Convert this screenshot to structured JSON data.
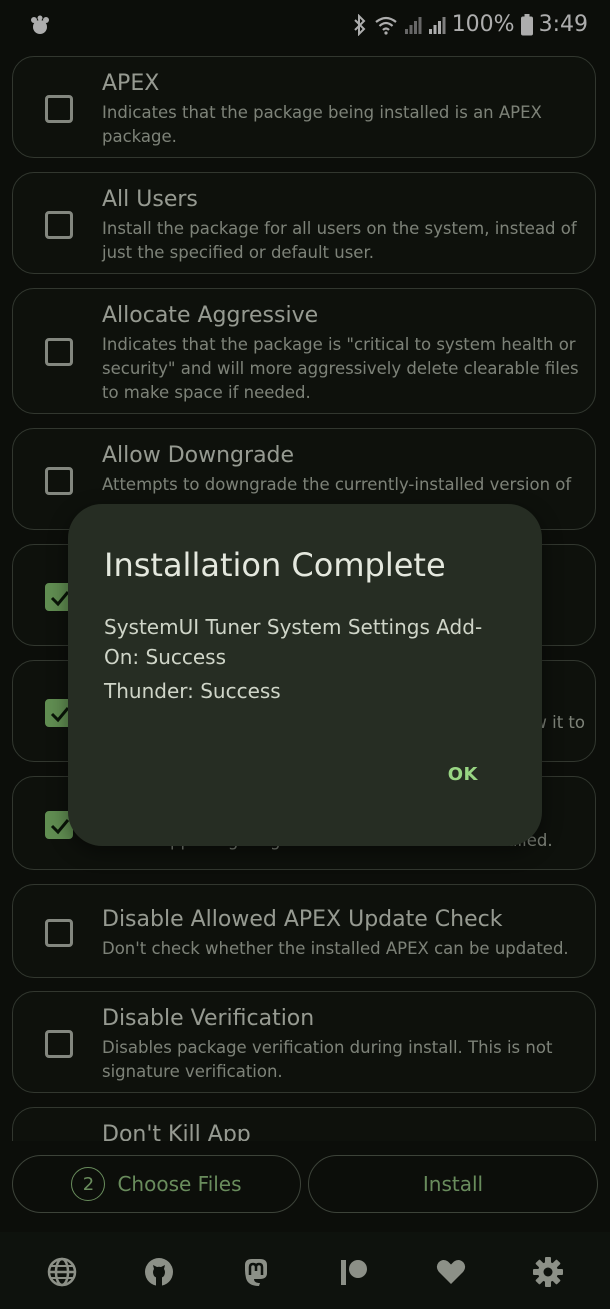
{
  "status_bar": {
    "battery": "100%",
    "time": "3:49",
    "icons": [
      "app-notification-icon",
      "bluetooth-icon",
      "wifi-icon",
      "signal-icon",
      "signal-icon",
      "battery-icon"
    ]
  },
  "options": [
    {
      "title": "APEX",
      "desc": "Indicates that the package being installed is an APEX package.",
      "checked": false
    },
    {
      "title": "All Users",
      "desc": "Install the package for all users on the system, instead of just the specified or default user.",
      "checked": false
    },
    {
      "title": "Allocate Aggressive",
      "desc": "Indicates that the package is \"critical to system health or security\" and will more aggressively delete clearable files to make space if needed.",
      "checked": false
    },
    {
      "title": "Allow Downgrade",
      "desc": "Attempts to downgrade the currently-installed version of",
      "checked": false
    },
    {
      "title": "",
      "desc": "",
      "checked": true
    },
    {
      "title": "",
      "desc": "w it to",
      "checked": true
    },
    {
      "title": "",
      "desc": "Allows apps targeting old SDK versions to be installed.",
      "checked": true
    },
    {
      "title": "Disable Allowed APEX Update Check",
      "desc": "Don't check whether the installed APEX can be updated.",
      "checked": false
    },
    {
      "title": "Disable Verification",
      "desc": "Disables package verification during install. This is not signature verification.",
      "checked": false
    },
    {
      "title": "Don't Kill App",
      "desc": "",
      "checked": false
    }
  ],
  "dialog": {
    "title": "Installation Complete",
    "lines": [
      "SystemUI Tuner System Settings Add-On: Success",
      "Thunder: Success"
    ],
    "ok": "OK"
  },
  "bottom": {
    "files_count": "2",
    "choose_files": "Choose Files",
    "install": "Install"
  },
  "nav": [
    "globe-icon",
    "github-icon",
    "mastodon-icon",
    "patreon-icon",
    "heart-icon",
    "gear-icon"
  ],
  "colors": {
    "accent": "#9bcf88",
    "checkbox_checked": "#8fd27a",
    "background": "#121610",
    "dialog": "#262d23"
  }
}
